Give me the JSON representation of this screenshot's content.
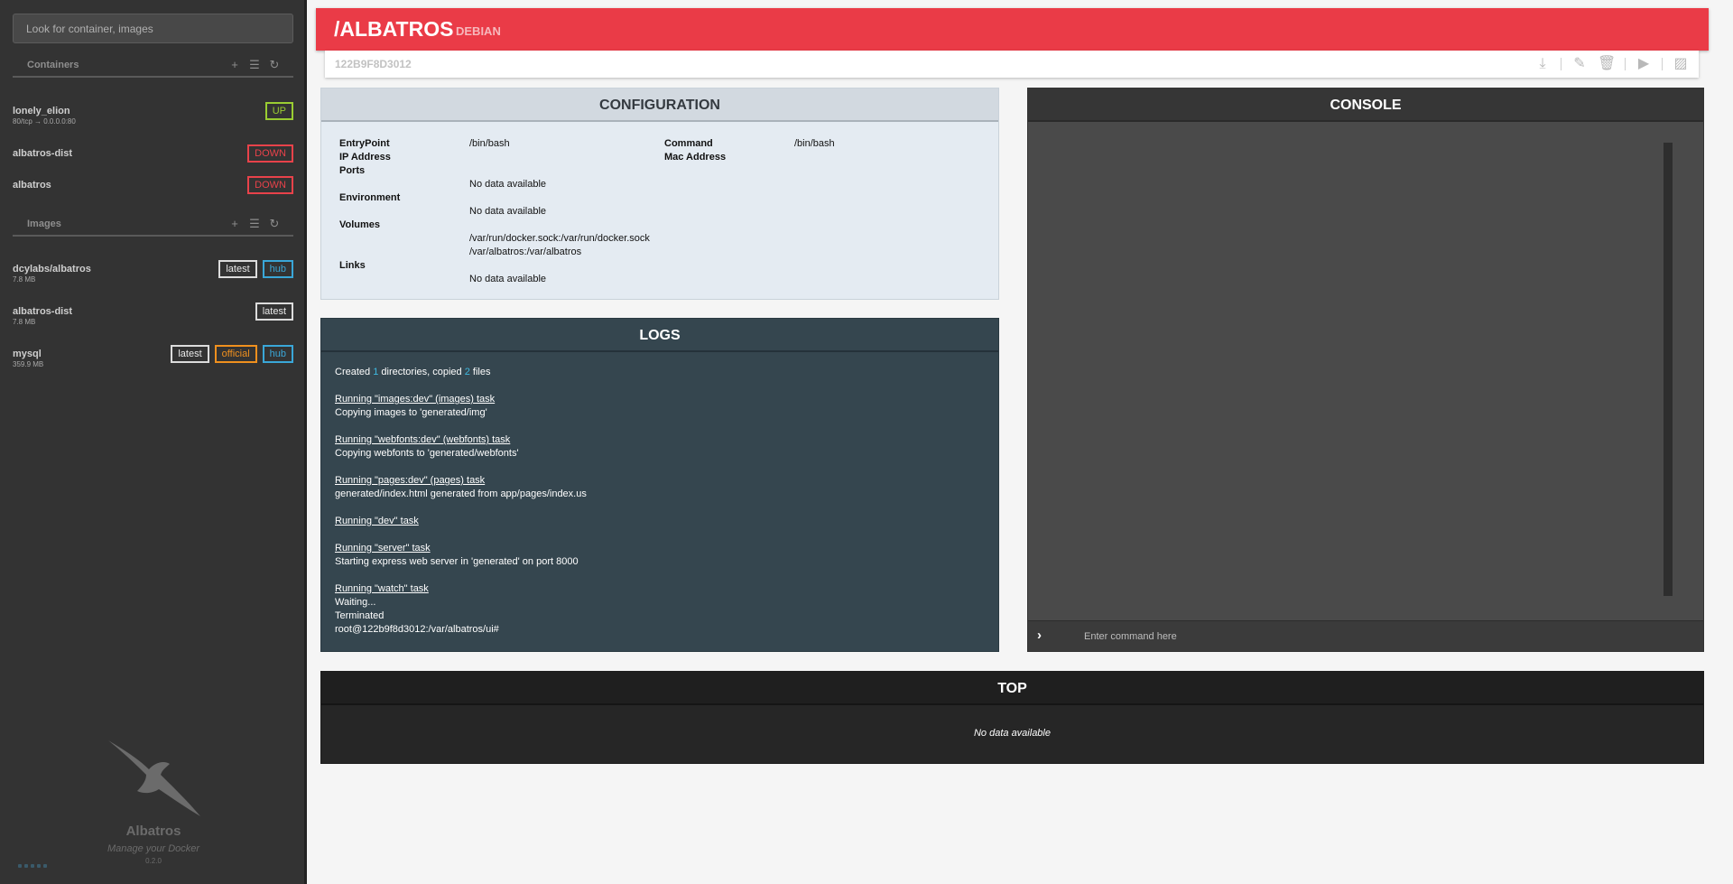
{
  "colors": {
    "accent": "#ea3b47",
    "up": "#9acd32",
    "down": "#e8424a",
    "hub": "#3aa7d8",
    "official": "#f0901e"
  },
  "sidebar": {
    "search_placeholder": "Look for container, images",
    "containers": {
      "title": "Containers",
      "tools": [
        "plus-icon",
        "list-icon",
        "refresh-icon"
      ],
      "items": [
        {
          "name": "lonely_elion",
          "sub": "80/tcp → 0.0.0.0:80",
          "status": "UP"
        },
        {
          "name": "albatros-dist",
          "sub": "",
          "status": "DOWN"
        },
        {
          "name": "albatros",
          "sub": "",
          "status": "DOWN"
        }
      ]
    },
    "images": {
      "title": "Images",
      "tools": [
        "plus-icon",
        "list-icon",
        "refresh-icon"
      ],
      "items": [
        {
          "name": "dcylabs/albatros",
          "size": "7.8 MB",
          "tags": [
            "latest",
            "hub"
          ]
        },
        {
          "name": "albatros-dist",
          "size": "7.8 MB",
          "tags": [
            "latest"
          ]
        },
        {
          "name": "mysql",
          "size": "359.9 MB",
          "tags": [
            "latest",
            "official",
            "hub"
          ]
        }
      ]
    },
    "brand": {
      "name": "Albatros",
      "tagline": "Manage your Docker",
      "version": "0.2.0"
    }
  },
  "header": {
    "title": "/ALBATROS",
    "subtitle": "DEBIAN",
    "container_id": "122B9F8D3012",
    "actions": [
      "download-icon",
      "edit-icon",
      "trash-icon",
      "play-icon",
      "image-icon"
    ]
  },
  "config": {
    "title": "CONFIGURATION",
    "entrypoint_label": "EntryPoint",
    "entrypoint": "/bin/bash",
    "command_label": "Command",
    "command": "/bin/bash",
    "ip_label": "IP Address",
    "mac_label": "Mac Address",
    "ports_label": "Ports",
    "ports": "No data available",
    "env_label": "Environment",
    "env": "No data available",
    "volumes_label": "Volumes",
    "volumes": [
      "/var/run/docker.sock:/var/run/docker.sock",
      "/var/albatros:/var/albatros"
    ],
    "links_label": "Links",
    "links": "No data available"
  },
  "logs": {
    "title": "LOGS",
    "created_pre": "Created ",
    "created_n1": "1",
    "created_mid": " directories, copied ",
    "created_n2": "2",
    "created_post": " files",
    "lines": [
      "Running \"images:dev\" (images) task",
      "Copying images to 'generated/img'",
      "Running \"webfonts:dev\" (webfonts) task",
      "Copying webfonts to 'generated/webfonts'",
      "Running \"pages:dev\" (pages) task",
      "generated/index.html generated from app/pages/index.us",
      "Running \"dev\" task",
      "Running \"server\" task",
      "Starting express web server in 'generated' on port 8000",
      "Running \"watch\" task",
      "Waiting...",
      "Terminated",
      "root@122b9f8d3012:/var/albatros/ui#"
    ]
  },
  "console": {
    "title": "CONSOLE",
    "placeholder": "Enter command here"
  },
  "top": {
    "title": "TOP",
    "empty": "No data available"
  }
}
